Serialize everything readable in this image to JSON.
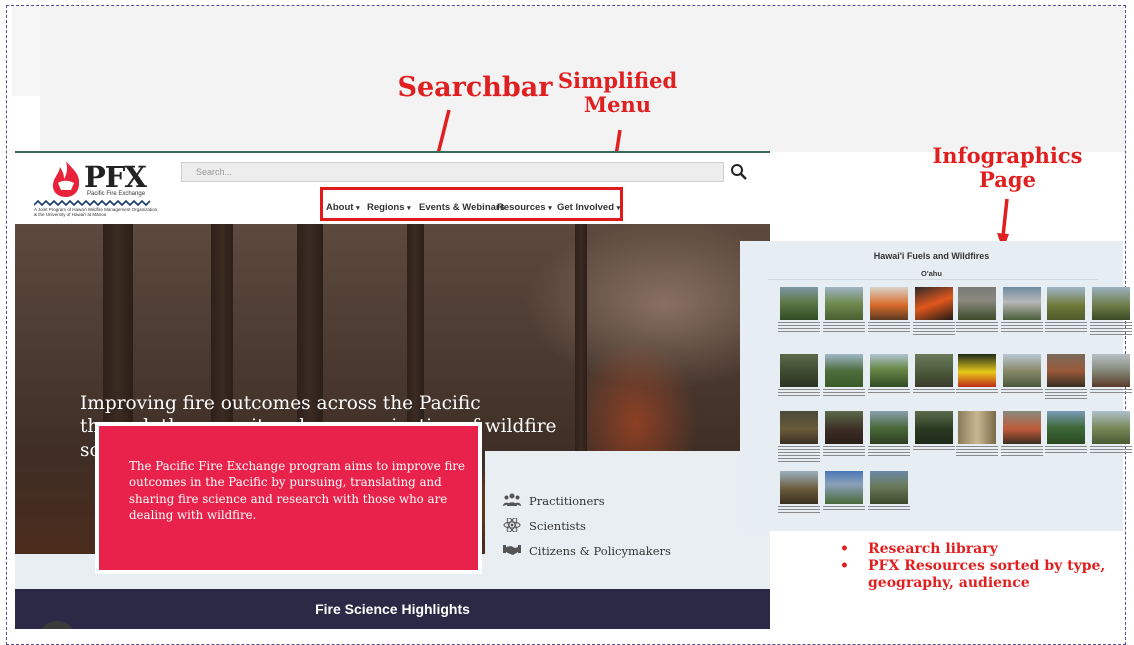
{
  "annotations": {
    "searchbar": "Searchbar",
    "simplified_menu": [
      "Simplified",
      "Menu"
    ],
    "infographics_page": [
      "Infographics",
      "Page"
    ]
  },
  "site": {
    "logo_text": "PFX",
    "logo_subtitle": "Pacific Fire Exchange",
    "logo_tagline": "A Joint Program of Hawai'i Wildfire Management Organization & the University of Hawai'i at Mānoa",
    "search_placeholder": "Search...",
    "menu": [
      "About",
      "Regions",
      "Events & Webinars",
      "Resources",
      "Get Involved"
    ],
    "hero_text": "Improving fire outcomes across the Pacific through the pursuit and communication of wildfire science.",
    "mission_text": "The Pacific Fire Exchange program aims to improve fire outcomes in the Pacific by pursuing, translating and sharing fire science and research with those who are dealing with wildfire.",
    "audiences": [
      {
        "icon": "people-icon",
        "label": "Practitioners"
      },
      {
        "icon": "atom-icon",
        "label": "Scientists"
      },
      {
        "icon": "handshake-icon",
        "label": "Citizens & Policymakers"
      }
    ],
    "footer_title": "Fire Science Highlights"
  },
  "infographics": {
    "title": "Hawai'i Fuels and Wildfires",
    "subtitle": "O'ahu"
  },
  "features": [
    "Research library",
    "PFX Resources sorted by type, geography, audience"
  ]
}
